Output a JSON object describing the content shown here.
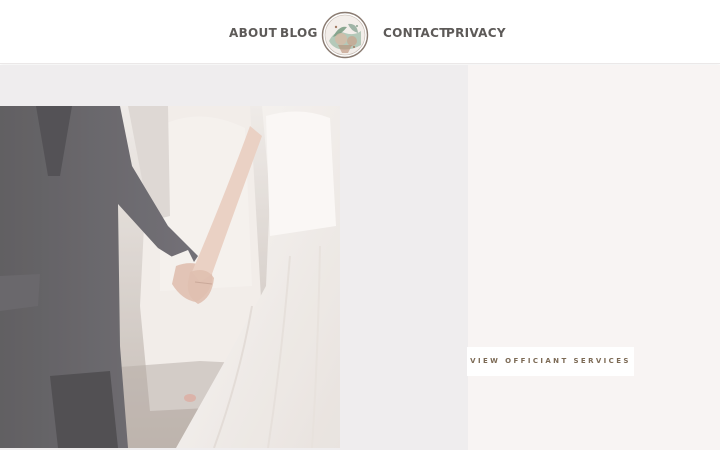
{
  "nav": {
    "left": [
      {
        "label": "ABOUT"
      },
      {
        "label": "BLOG"
      }
    ],
    "right": [
      {
        "label": "CONTACT"
      },
      {
        "label": "PRIVACY"
      }
    ],
    "logo_icon": "watercolor-botanical-logo-icon"
  },
  "hero": {
    "image_subject": "couple-holding-hands-photo",
    "cta_label": "VIEW OFFICIANT SERVICES"
  },
  "colors": {
    "nav_text": "#5d5a58",
    "left_panel_bg": "#efedee",
    "right_panel_bg": "#f8f4f3",
    "cta_text": "#7c6a55",
    "logo_ring": "#8a7b71"
  }
}
